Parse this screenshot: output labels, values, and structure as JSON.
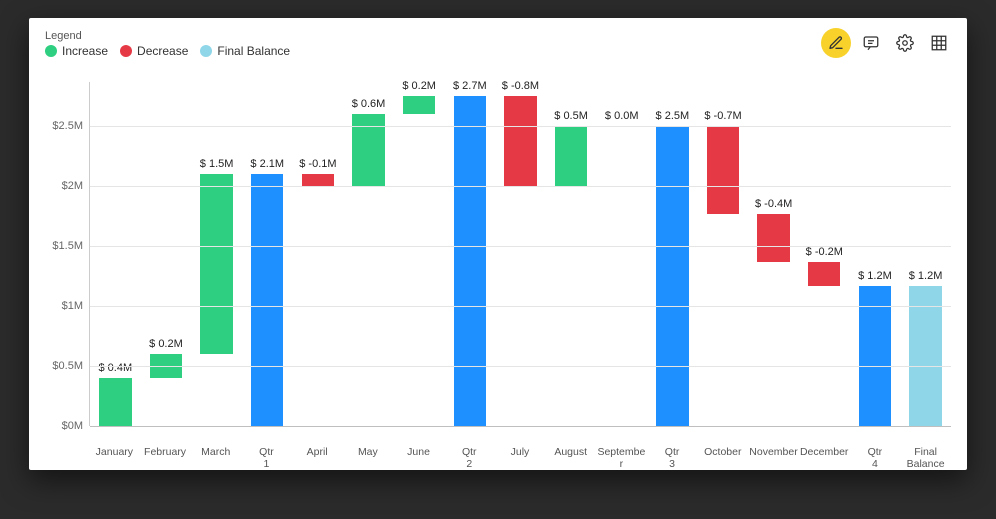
{
  "legend": {
    "title": "Legend",
    "items": [
      {
        "label": "Increase",
        "color": "#2ecf80"
      },
      {
        "label": "Decrease",
        "color": "#e63946"
      },
      {
        "label": "Final Balance",
        "color": "#8fd6e8"
      }
    ]
  },
  "toolbar": {
    "edit_icon": "edit-icon",
    "comment_icon": "comment-icon",
    "settings_icon": "gear-icon",
    "grid_icon": "grid-icon"
  },
  "colors": {
    "increase": "#2ecf80",
    "decrease": "#e63946",
    "total": "#1e90ff",
    "final": "#8fd6e8"
  },
  "chart_data": {
    "type": "waterfall",
    "ylabel": "",
    "ylim": [
      0,
      2.75
    ],
    "yticks": [
      {
        "v": 0.0,
        "label": "$0M"
      },
      {
        "v": 0.5,
        "label": "$0.5M"
      },
      {
        "v": 1.0,
        "label": "$1M"
      },
      {
        "v": 1.5,
        "label": "$1.5M"
      },
      {
        "v": 2.0,
        "label": "$2M"
      },
      {
        "v": 2.5,
        "label": "$2.5M"
      }
    ],
    "items": [
      {
        "name": "January",
        "kind": "increase",
        "delta": 0.4,
        "start": 0.0,
        "end": 0.4,
        "label": "$ 0.4M"
      },
      {
        "name": "February",
        "kind": "increase",
        "delta": 0.2,
        "start": 0.4,
        "end": 0.6,
        "label": "$ 0.2M"
      },
      {
        "name": "March",
        "kind": "increase",
        "delta": 1.5,
        "start": 0.6,
        "end": 2.1,
        "label": "$ 1.5M"
      },
      {
        "name": "Qtr 1",
        "kind": "total",
        "delta": 2.1,
        "start": 0.0,
        "end": 2.1,
        "label": "$ 2.1M"
      },
      {
        "name": "April",
        "kind": "decrease",
        "delta": -0.1,
        "start": 2.1,
        "end": 2.0,
        "label": "$ -0.1M"
      },
      {
        "name": "May",
        "kind": "increase",
        "delta": 0.6,
        "start": 2.0,
        "end": 2.6,
        "label": "$ 0.6M"
      },
      {
        "name": "June",
        "kind": "increase",
        "delta": 0.2,
        "start": 2.6,
        "end": 2.75,
        "label": "$ 0.2M"
      },
      {
        "name": "Qtr 2",
        "kind": "total",
        "delta": 2.7,
        "start": 0.0,
        "end": 2.75,
        "label": "$ 2.7M"
      },
      {
        "name": "July",
        "kind": "decrease",
        "delta": -0.8,
        "start": 2.75,
        "end": 2.0,
        "label": "$ -0.8M"
      },
      {
        "name": "August",
        "kind": "increase",
        "delta": 0.5,
        "start": 2.0,
        "end": 2.5,
        "label": "$ 0.5M"
      },
      {
        "name": "September",
        "kind": "decrease",
        "delta": 0.0,
        "start": 2.5,
        "end": 2.5,
        "label": "$ 0.0M"
      },
      {
        "name": "Qtr 3",
        "kind": "total",
        "delta": 2.5,
        "start": 0.0,
        "end": 2.5,
        "label": "$ 2.5M"
      },
      {
        "name": "October",
        "kind": "decrease",
        "delta": -0.7,
        "start": 2.5,
        "end": 1.77,
        "label": "$ -0.7M"
      },
      {
        "name": "November",
        "kind": "decrease",
        "delta": -0.4,
        "start": 1.77,
        "end": 1.37,
        "label": "$ -0.4M"
      },
      {
        "name": "December",
        "kind": "decrease",
        "delta": -0.2,
        "start": 1.37,
        "end": 1.17,
        "label": "$ -0.2M"
      },
      {
        "name": "Qtr 4",
        "kind": "total",
        "delta": 1.2,
        "start": 0.0,
        "end": 1.17,
        "label": "$ 1.2M"
      },
      {
        "name": "Final Balance",
        "kind": "final",
        "delta": 1.2,
        "start": 0.0,
        "end": 1.17,
        "label": "$ 1.2M"
      }
    ]
  }
}
